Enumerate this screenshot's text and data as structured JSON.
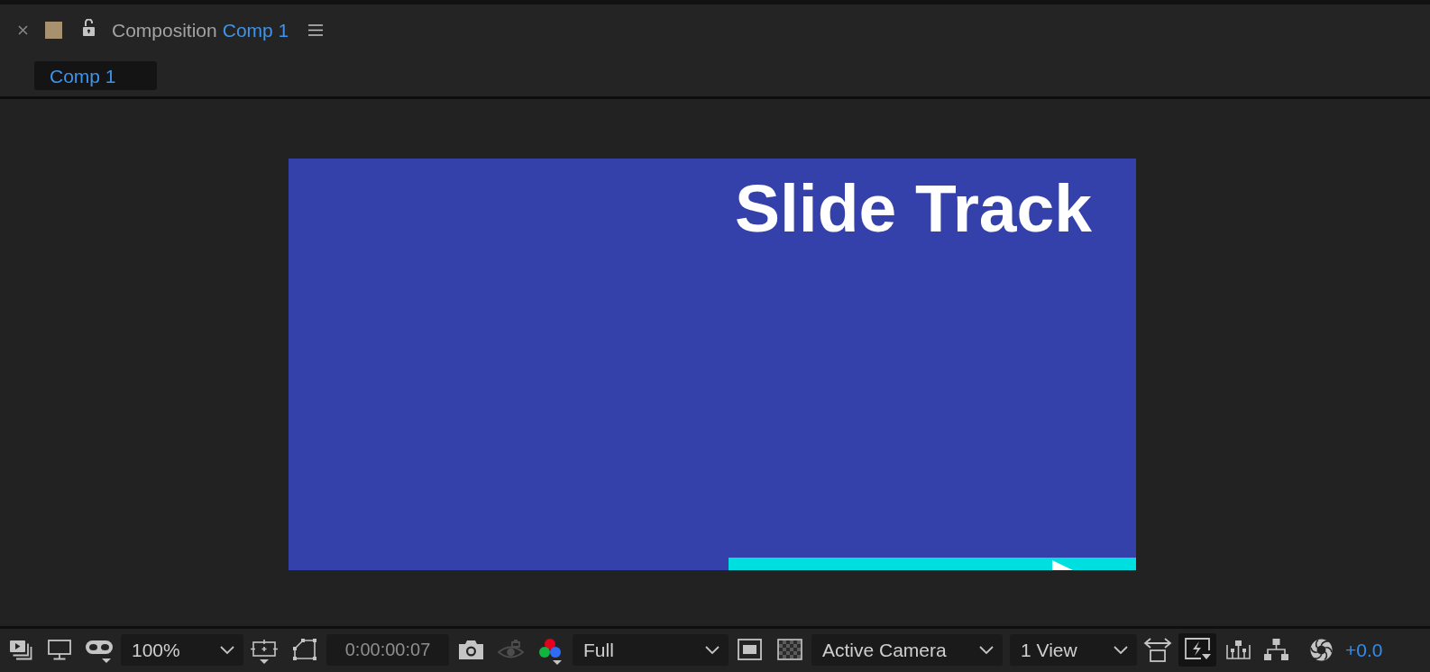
{
  "panel": {
    "title": "Composition",
    "composition": "Comp 1",
    "locked": false
  },
  "tabs": [
    {
      "label": "Comp 1",
      "selected": true
    }
  ],
  "composition": {
    "title": "Slide Track"
  },
  "toolbar": {
    "magnification": "100%",
    "timecode": "0:00:00:07",
    "show_snapshot": {
      "disabled": true
    },
    "resolution": "Full",
    "view": "Active Camera",
    "layout": "1 View",
    "fast_previews": {
      "active": true
    },
    "exposure": "+0.0"
  }
}
